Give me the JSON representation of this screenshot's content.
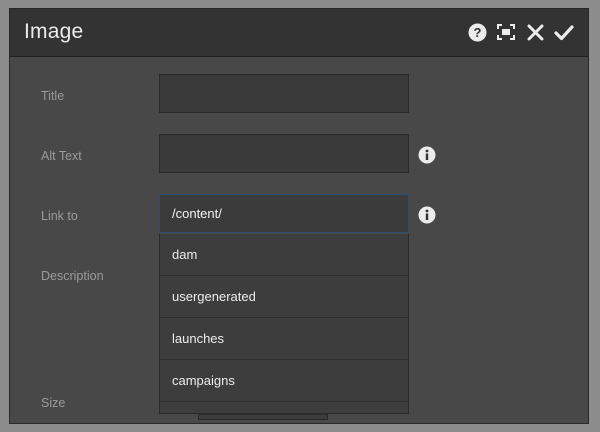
{
  "dialog": {
    "title": "Image",
    "toolbar_icons": [
      "help-icon",
      "fullscreen-icon",
      "close-icon",
      "checkmark-icon"
    ]
  },
  "form": {
    "title_label": "Title",
    "title_value": "",
    "alt_text_label": "Alt Text",
    "alt_text_value": "",
    "link_to_label": "Link to",
    "link_to_value": "/content/",
    "description_label": "Description",
    "size_label": "Size"
  },
  "autocomplete": {
    "items": [
      "dam",
      "usergenerated",
      "launches",
      "campaigns"
    ]
  },
  "colors": {
    "dialog_bg": "#484848",
    "titlebar_bg": "#333333",
    "field_bg": "#3a3a3a",
    "focus_border": "#2d4f74"
  }
}
